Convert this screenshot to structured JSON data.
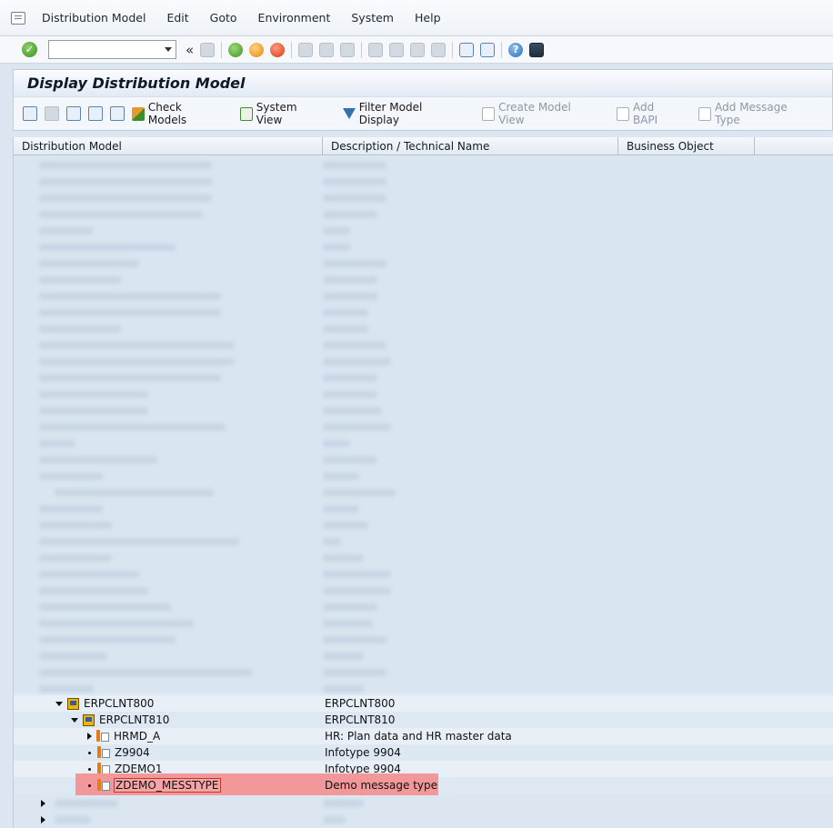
{
  "menu": {
    "items": [
      "Distribution Model",
      "Edit",
      "Goto",
      "Environment",
      "System",
      "Help"
    ]
  },
  "toolbar": {
    "command_value": "",
    "back_symbol": "«"
  },
  "title": "Display Distribution Model",
  "app_toolbar": {
    "check_models": "Check Models",
    "system_view": "System View",
    "filter_model_display": "Filter Model Display",
    "create_model_view": "Create Model View",
    "add_bapi": "Add BAPI",
    "add_message_type": "Add Message Type"
  },
  "table": {
    "headers": [
      "Distribution Model",
      "Description / Technical Name",
      "Business Object"
    ],
    "rows": [
      {
        "label": "ERPCLNT800",
        "desc": "ERPCLNT800"
      },
      {
        "label": "ERPCLNT810",
        "desc": "ERPCLNT810"
      },
      {
        "label": "HRMD_A",
        "desc": "HR: Plan data and HR master data"
      },
      {
        "label": "Z9904",
        "desc": "Infotype 9904"
      },
      {
        "label": "ZDEMO1",
        "desc": "Infotype 9904"
      },
      {
        "label": "ZDEMO_MESSTYPE",
        "desc": "Demo message type"
      }
    ]
  },
  "colors": {
    "selection_highlight": "#f3989a",
    "background": "#dbe6f1"
  }
}
